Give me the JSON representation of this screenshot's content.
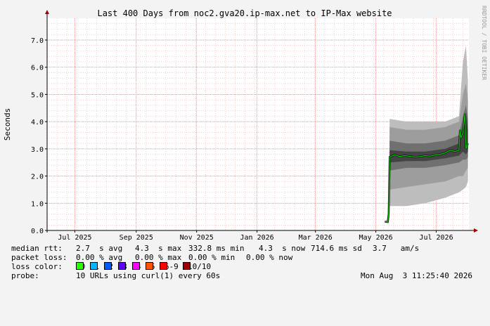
{
  "chart_data": {
    "type": "area",
    "title": "Last 400 Days from noc2.gva20.ip-max.net to IP-Max website",
    "ylabel": "Seconds",
    "watermark": "RRDTOOL / TOBI OETIKER",
    "ylim": [
      0,
      7.8
    ],
    "y_ticks": [
      "0.0",
      "1.0",
      "2.0",
      "3.0",
      "4.0",
      "5.0",
      "6.0",
      "7.0"
    ],
    "x_ticks": [
      "Jul 2025",
      "Sep 2025",
      "Nov 2025",
      "Jan 2026",
      "Mar 2026",
      "May 2026",
      "Jul 2026"
    ],
    "x_start": "2025-06-03",
    "x_end": "2026-08-03",
    "grid": true,
    "series": [
      {
        "name": "median rtt",
        "color": "#00cc00",
        "points": [
          [
            "2026-05-10",
            0.32
          ],
          [
            "2026-05-13",
            0.31
          ],
          [
            "2026-05-14",
            0.6
          ],
          [
            "2026-05-15",
            2.7
          ],
          [
            "2026-05-20",
            2.78
          ],
          [
            "2026-05-25",
            2.72
          ],
          [
            "2026-05-30",
            2.75
          ],
          [
            "2026-06-05",
            2.72
          ],
          [
            "2026-06-10",
            2.7
          ],
          [
            "2026-06-15",
            2.72
          ],
          [
            "2026-06-20",
            2.75
          ],
          [
            "2026-06-25",
            2.73
          ],
          [
            "2026-06-30",
            2.78
          ],
          [
            "2026-07-05",
            2.8
          ],
          [
            "2026-07-10",
            2.85
          ],
          [
            "2026-07-15",
            2.95
          ],
          [
            "2026-07-20",
            2.9
          ],
          [
            "2026-07-24",
            2.95
          ],
          [
            "2026-07-25",
            3.7
          ],
          [
            "2026-07-26",
            3.4
          ],
          [
            "2026-07-28",
            3.6
          ],
          [
            "2026-07-30",
            4.3
          ],
          [
            "2026-07-31",
            3.0
          ],
          [
            "2026-08-02",
            3.2
          ]
        ]
      }
    ],
    "smoke_bands": [
      {
        "color": "#bdbdbd",
        "points": [
          [
            "2026-05-14",
            0.0,
            0.8
          ],
          [
            "2026-05-15",
            0.9,
            4.1
          ],
          [
            "2026-06-01",
            0.9,
            4.0
          ],
          [
            "2026-06-20",
            1.0,
            4.0
          ],
          [
            "2026-07-10",
            1.2,
            4.0
          ],
          [
            "2026-07-24",
            1.4,
            4.2
          ],
          [
            "2026-07-28",
            1.5,
            6.2
          ],
          [
            "2026-07-31",
            1.6,
            6.8
          ],
          [
            "2026-08-02",
            1.8,
            5.5
          ]
        ]
      },
      {
        "color": "#9d9d9d",
        "points": [
          [
            "2026-05-15",
            1.5,
            3.8
          ],
          [
            "2026-06-01",
            1.6,
            3.7
          ],
          [
            "2026-06-20",
            1.7,
            3.7
          ],
          [
            "2026-07-10",
            1.8,
            3.8
          ],
          [
            "2026-07-24",
            2.0,
            4.0
          ],
          [
            "2026-07-28",
            2.0,
            5.0
          ],
          [
            "2026-07-31",
            2.2,
            5.4
          ],
          [
            "2026-08-02",
            2.3,
            4.8
          ]
        ]
      },
      {
        "color": "#707070",
        "points": [
          [
            "2026-05-15",
            2.2,
            3.3
          ],
          [
            "2026-06-01",
            2.3,
            3.2
          ],
          [
            "2026-06-20",
            2.3,
            3.2
          ],
          [
            "2026-07-10",
            2.4,
            3.3
          ],
          [
            "2026-07-24",
            2.5,
            3.5
          ],
          [
            "2026-07-28",
            2.6,
            4.2
          ],
          [
            "2026-07-31",
            2.6,
            4.6
          ],
          [
            "2026-08-02",
            2.7,
            4.1
          ]
        ]
      },
      {
        "color": "#444444",
        "points": [
          [
            "2026-05-15",
            2.5,
            2.95
          ],
          [
            "2026-06-01",
            2.55,
            2.9
          ],
          [
            "2026-06-20",
            2.55,
            2.9
          ],
          [
            "2026-07-10",
            2.65,
            3.0
          ],
          [
            "2026-07-24",
            2.75,
            3.2
          ],
          [
            "2026-07-28",
            2.9,
            3.9
          ],
          [
            "2026-07-31",
            2.8,
            4.3
          ],
          [
            "2026-08-02",
            2.9,
            3.7
          ]
        ]
      }
    ]
  },
  "stats": {
    "rtt_label": "median rtt:",
    "avg": "2.7  s avg",
    "max": "4.3  s max",
    "min": "332.8 ms min",
    "now": "4.3  s now",
    "sd": "714.6 ms sd",
    "am": "3.7   am/s",
    "loss_label": "packet loss:",
    "loss_avg": "0.00 % avg",
    "loss_max": "0.00 % max",
    "loss_min": "0.00 % min",
    "loss_now": "0.00 % now",
    "color_label": "loss color:",
    "legend": [
      {
        "label": "0",
        "color": "#26ff00"
      },
      {
        "label": "1",
        "color": "#00b8ff"
      },
      {
        "label": "2",
        "color": "#0059ff"
      },
      {
        "label": "3",
        "color": "#5e00ff"
      },
      {
        "label": "4",
        "color": "#ff00ff"
      },
      {
        "label": "5",
        "color": "#ff5500"
      },
      {
        "label": "6-9",
        "color": "#ff0000"
      },
      {
        "label": "10/10",
        "color": "#a10000"
      }
    ],
    "probe_label": "probe:",
    "probe_text": "10 URLs using curl(1) every 60s",
    "timestamp": "Mon Aug  3 11:25:40 2026"
  }
}
